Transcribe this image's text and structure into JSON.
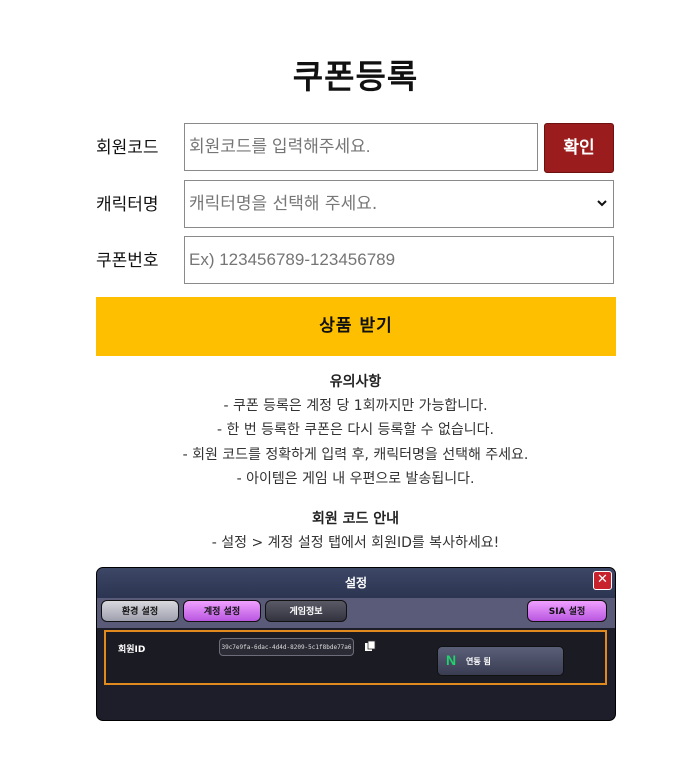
{
  "title": "쿠폰등록",
  "member_code": {
    "label": "회원코드",
    "placeholder": "회원코드를 입력해주세요.",
    "confirm_label": "확인"
  },
  "character": {
    "label": "캐릭터명",
    "selected": "캐릭터명을 선택해 주세요."
  },
  "coupon": {
    "label": "쿠폰번호",
    "placeholder": "Ex) 123456789-123456789"
  },
  "receive_label": "상품 받기",
  "notes": {
    "heading": "유의사항",
    "lines": [
      "- 쿠폰 등록은 계정 당 1회까지만 가능합니다.",
      "- 한 번 등록한 쿠폰은 다시 등록할 수 없습니다.",
      "- 회원 코드를 정확하게 입력 후, 캐릭터명을 선택해 주세요.",
      "- 아이템은 게임 내 우편으로 발송됩니다."
    ]
  },
  "guide": {
    "heading": "회원 코드 안내",
    "line": "- 설정 > 계정 설정 탭에서 회원ID를 복사하세요!"
  },
  "game_panel": {
    "title": "설정",
    "tabs": [
      "환경 설정",
      "계정 설정",
      "게임정보"
    ],
    "right_tab": "SIA 설정",
    "member_id_label": "회원ID",
    "member_id_value": "39c7e9fa-6dac-4d4d-8209-5c1f8bde77a6",
    "link_label": "연동 됨",
    "link_icon_letter": "N",
    "colors": {
      "accent_orange": "#e08a1e",
      "close_red": "#c8232c",
      "naver_green": "#20d36a"
    }
  },
  "colors": {
    "confirm": "#9a1c1c",
    "receive": "#fdbf00"
  }
}
